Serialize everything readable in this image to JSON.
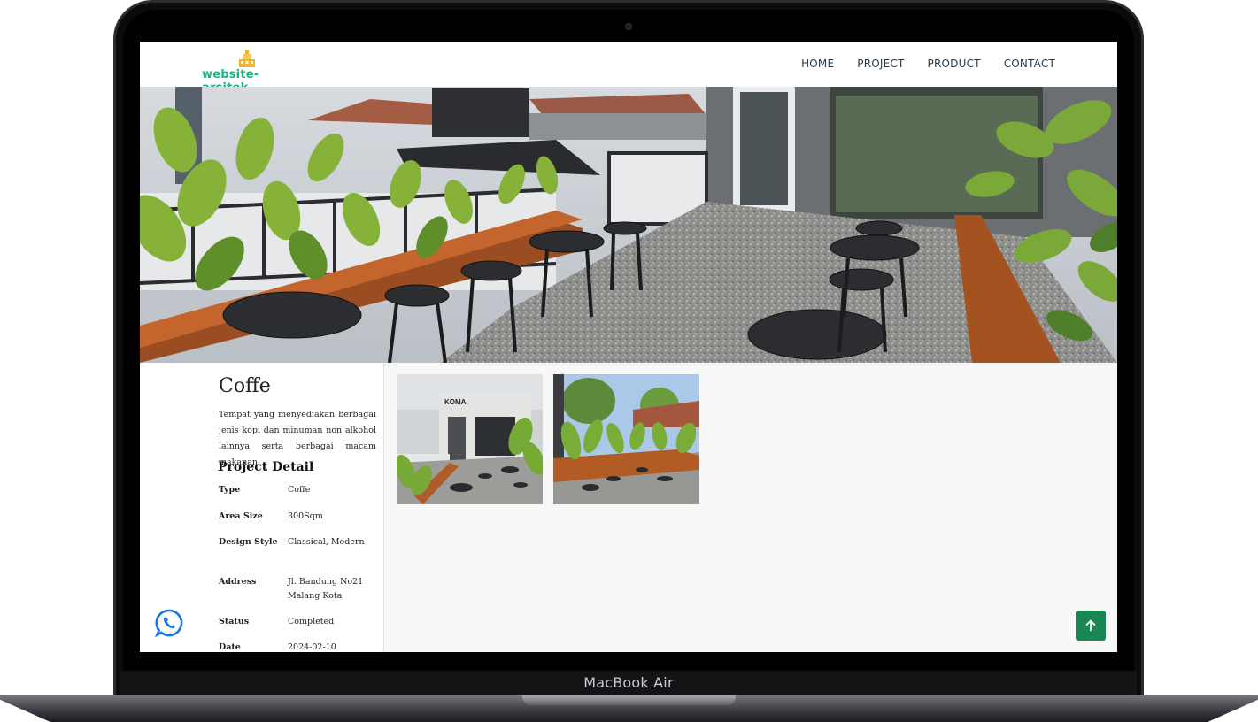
{
  "device": {
    "label": "MacBook Air"
  },
  "navbar": {
    "logo_text": "website-arsitek",
    "links": [
      "HOME",
      "PROJECT",
      "PRODUCT",
      "CONTACT"
    ]
  },
  "project": {
    "title": "Coffe",
    "description": "Tempat yang menyediakan berbagai jenis kopi dan minuman non alkohol lainnya serta berbagai macam makanan",
    "detail_heading": "Project Detail",
    "details": [
      {
        "key": "Type",
        "value": "Coffe"
      },
      {
        "key": "Area Size",
        "value": "300Sqm"
      },
      {
        "key": "Design Style",
        "value": "Classical, Modern"
      },
      {
        "key": "Address",
        "value": "Jl. Bandung No21 Malang Kota"
      },
      {
        "key": "Status",
        "value": "Completed"
      },
      {
        "key": "Date",
        "value": "2024-02-10"
      }
    ],
    "gallery_sign_text": "KOMA,"
  },
  "floating": {
    "whatsapp_icon": "whatsapp-icon",
    "scroll_top_icon": "arrow-up-icon"
  },
  "colors": {
    "accent": "#12b886",
    "nav_text": "#1f3a4d",
    "scroll_top_bg": "#198754",
    "whatsapp": "#1a73e8"
  }
}
